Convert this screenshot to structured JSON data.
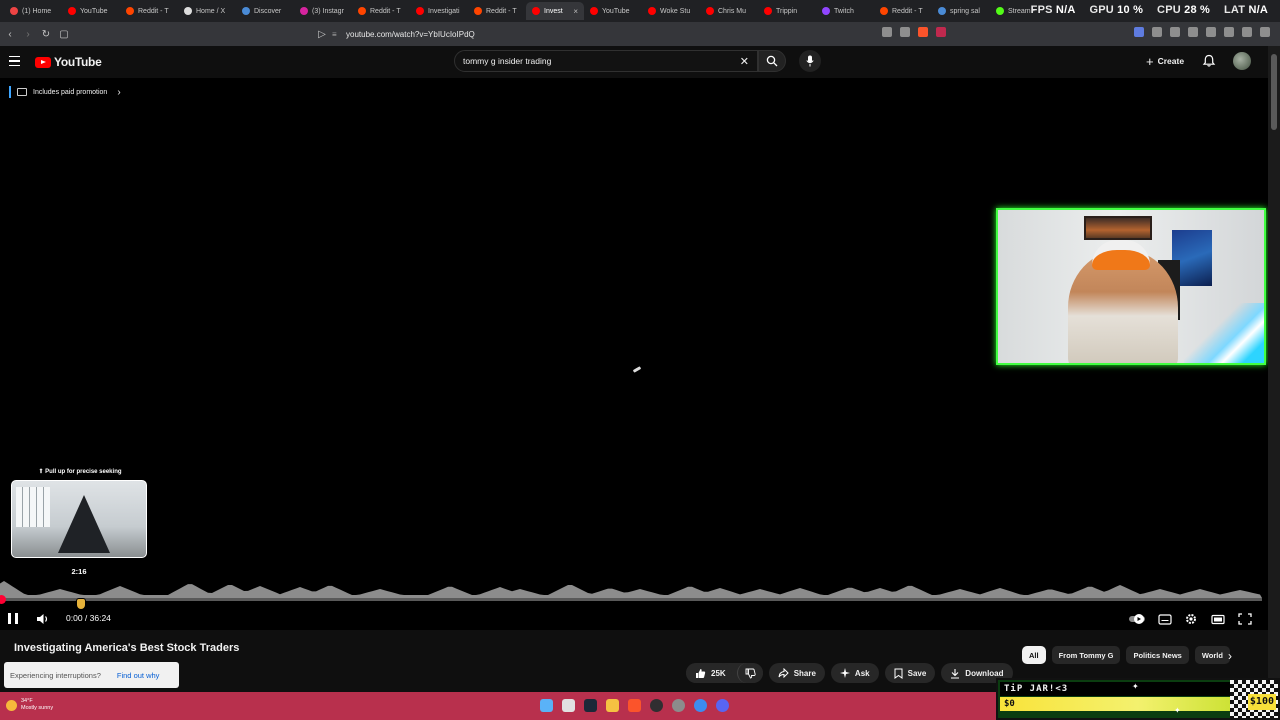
{
  "browser": {
    "tabs": [
      {
        "label": "(1) Home",
        "color": "#e44"
      },
      {
        "label": "YouTube",
        "color": "#f00"
      },
      {
        "label": "Reddit - T",
        "color": "#ff4500"
      },
      {
        "label": "Home / X",
        "color": "#ddd"
      },
      {
        "label": "Discover",
        "color": "#4a8bd6"
      },
      {
        "label": "(3) Instagr",
        "color": "#d6249f"
      },
      {
        "label": "Reddit - T",
        "color": "#ff4500"
      },
      {
        "label": "Investigati",
        "color": "#f00"
      },
      {
        "label": "Reddit - T",
        "color": "#ff4500"
      },
      {
        "label": "Invest",
        "color": "#f00",
        "active": true
      },
      {
        "label": "YouTube",
        "color": "#f00"
      },
      {
        "label": "Woke Stu",
        "color": "#f00"
      },
      {
        "label": "Chris Mu",
        "color": "#f00"
      },
      {
        "label": "Trippin",
        "color": "#f00"
      },
      {
        "label": "Twitch",
        "color": "#9146ff"
      },
      {
        "label": "Reddit - T",
        "color": "#ff4500"
      },
      {
        "label": "spring sal",
        "color": "#4a8bd6"
      },
      {
        "label": "Stream -",
        "color": "#53fc18"
      }
    ],
    "close_glyph": "×",
    "url": "youtube.com/watch?v=YbIUcIoIPdQ"
  },
  "hud": {
    "fps_label": "FPS",
    "fps_value": "N/A",
    "gpu_label": "GPU",
    "gpu_value": "10 %",
    "cpu_label": "CPU",
    "cpu_value": "28 %",
    "lat_label": "LAT",
    "lat_value": "N/A"
  },
  "header": {
    "logo_text": "YouTube",
    "search_value": "tommy g insider trading",
    "create_label": "Create",
    "plus_glyph": "+",
    "clear_glyph": "✕"
  },
  "player": {
    "promo_label": "Includes paid promotion",
    "promo_chevron": "›",
    "seek_tip": "⇑ Pull up for precise seeking",
    "preview_time": "2:16",
    "time_display": "0:00 / 36:24",
    "progress_fraction": 0.004
  },
  "video": {
    "title": "Investigating America's Best Stock Traders",
    "interrupt_text": "Experiencing interruptions?",
    "interrupt_link": "Find out why",
    "like_count": "25K",
    "share_label": "Share",
    "ask_label": "Ask",
    "save_label": "Save",
    "download_label": "Download"
  },
  "chips": [
    {
      "label": "All",
      "selected": true
    },
    {
      "label": "From Tommy G",
      "selected": false
    },
    {
      "label": "Politics News",
      "selected": false
    },
    {
      "label": "World",
      "selected": false
    }
  ],
  "chip_next": "›",
  "taskbar": {
    "temperature": "34°F",
    "weather": "Mostly sunny"
  },
  "tipjar": {
    "title": "TiP JAR!<3",
    "current": "$0",
    "goal": "$100"
  },
  "colors": {
    "accent": "#ff0033",
    "webcam_border": "#42ff42",
    "taskbar": "#b8304d"
  }
}
